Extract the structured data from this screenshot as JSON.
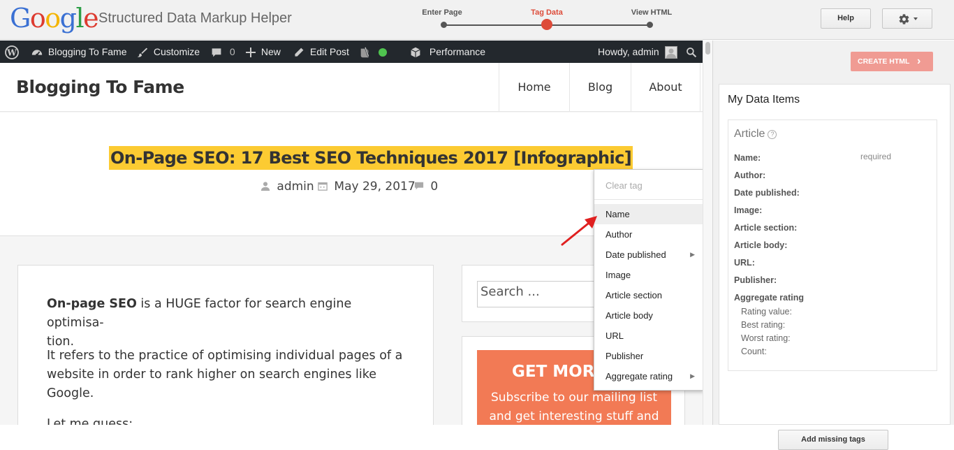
{
  "header": {
    "logo_letters": [
      {
        "char": "G",
        "color": "#3a70d3"
      },
      {
        "char": "o",
        "color": "#dd3b30"
      },
      {
        "char": "o",
        "color": "#f4b400"
      },
      {
        "char": "g",
        "color": "#3a70d3"
      },
      {
        "char": "l",
        "color": "#2d9e47"
      },
      {
        "char": "e",
        "color": "#dd3b30"
      }
    ],
    "app_title": "Structured Data Markup Helper",
    "steps": [
      "Enter Page",
      "Tag Data",
      "View HTML"
    ],
    "active_step": "Tag Data",
    "help_label": "Help",
    "settings_icon": "gear-icon"
  },
  "wp_admin_bar": {
    "site": "Blogging To Fame",
    "customize": "Customize",
    "comments_count": "0",
    "new": "New",
    "edit_post": "Edit Post",
    "performance": "Performance",
    "howdy": "Howdy, admin"
  },
  "site": {
    "name": "Blogging To Fame",
    "nav": [
      "Home",
      "Blog",
      "About"
    ]
  },
  "post": {
    "title": "On-Page SEO: 17 Best SEO Techniques 2017 [Infographic]",
    "author": "admin",
    "date": "May 29, 2017",
    "comments": "0",
    "p1_bold": "On-page SEO",
    "p1_rest": " is a HUGE factor for search engine optimisa-",
    "p1_line2": "tion.",
    "p2_line1": "It refers to the practice of optimising individual pages of a",
    "p2_line2": "website in order to rank higher on search engines like",
    "p2_line3": "Google.",
    "p3": "Let me guess:"
  },
  "sidebar": {
    "search_placeholder": "Search ...",
    "subscribe_heading": "GET MORE S",
    "subscribe_line1": "Subscribe to our mailing list",
    "subscribe_line2": "and get interesting stuff and"
  },
  "context_menu": {
    "clear": "Clear tag",
    "items": [
      {
        "label": "Name",
        "submenu": false
      },
      {
        "label": "Author",
        "submenu": false
      },
      {
        "label": "Date published",
        "submenu": true
      },
      {
        "label": "Image",
        "submenu": false
      },
      {
        "label": "Article section",
        "submenu": false
      },
      {
        "label": "Article body",
        "submenu": false
      },
      {
        "label": "URL",
        "submenu": false
      },
      {
        "label": "Publisher",
        "submenu": false
      },
      {
        "label": "Aggregate rating",
        "submenu": true
      }
    ],
    "hovered": "Name",
    "submenu_arrow": "▶"
  },
  "right_panel": {
    "create_html": "CREATE HTML",
    "title": "My Data Items",
    "item_type": "Article",
    "help_icon": "?",
    "name_required": "required",
    "fields": [
      "Name:",
      "Author:",
      "Date published:",
      "Image:",
      "Article section:",
      "Article body:",
      "URL:",
      "Publisher:",
      "Aggregate rating"
    ],
    "rating_subfields": [
      "Rating value:",
      "Best rating:",
      "Worst rating:",
      "Count:"
    ],
    "add_missing": "Add missing tags"
  },
  "colors": {
    "accent_red": "#dd4b39",
    "highlight_yellow": "#fccb32",
    "annotation_arrow": "#e02020"
  }
}
